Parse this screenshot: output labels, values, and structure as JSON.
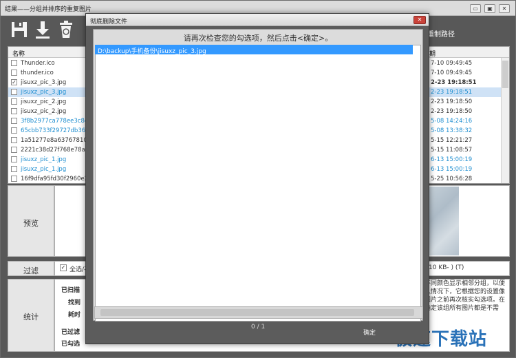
{
  "window": {
    "title": "结果——分组并排序的重复图片",
    "btn_min": "▭",
    "btn_max": "▣",
    "btn_close": "✕"
  },
  "toolbar": {
    "icons": [
      "save-icon",
      "download-icon",
      "trash-icon"
    ],
    "right_label": "重制路径"
  },
  "file_list": {
    "col_name": "名称",
    "col_date": "期",
    "rows": [
      {
        "name": "Thunder.ico",
        "date": "7-10 09:49:45",
        "checked": false,
        "blue": false,
        "bold": false,
        "selected": false
      },
      {
        "name": "thunder.ico",
        "date": "7-10 09:49:45",
        "checked": false,
        "blue": false,
        "bold": false,
        "selected": false
      },
      {
        "name": "jisuxz_pic_3.jpg",
        "date": "2-23 19:18:51",
        "checked": true,
        "blue": false,
        "bold": true,
        "selected": false
      },
      {
        "name": "jisuxz_pic_3.jpg",
        "date": "2-23 19:18:51",
        "checked": false,
        "blue": true,
        "bold": false,
        "selected": true
      },
      {
        "name": "jisuxz_pic_2.jpg",
        "date": "2-23 19:18:50",
        "checked": false,
        "blue": false,
        "bold": false,
        "selected": false
      },
      {
        "name": "jisuxz_pic_2.jpg",
        "date": "2-23 19:18:50",
        "checked": false,
        "blue": false,
        "bold": false,
        "selected": false
      },
      {
        "name": "3f8b2977ca778ee3c8ec5c",
        "date": "5-08 14:24:16",
        "checked": false,
        "blue": true,
        "bold": false,
        "selected": false
      },
      {
        "name": "65cbb733f29727db360a03",
        "date": "5-08 13:38:32",
        "checked": false,
        "blue": true,
        "bold": false,
        "selected": false
      },
      {
        "name": "1a51277e8a63767810b96b",
        "date": "5-15 12:21:27",
        "checked": false,
        "blue": false,
        "bold": false,
        "selected": false
      },
      {
        "name": "2221c38d27f768e78a5852",
        "date": "5-15 11:08:57",
        "checked": false,
        "blue": false,
        "bold": false,
        "selected": false
      },
      {
        "name": "jisuxz_pic_1.jpg",
        "date": "6-13 15:00:19",
        "checked": false,
        "blue": true,
        "bold": false,
        "selected": false
      },
      {
        "name": "jisuxz_pic_1.jpg",
        "date": "6-13 15:00:19",
        "checked": false,
        "blue": true,
        "bold": false,
        "selected": false
      },
      {
        "name": "16f9dfa95fd30f2960e2736",
        "date": "5-25 10:56:28",
        "checked": false,
        "blue": false,
        "bold": false,
        "selected": false
      }
    ]
  },
  "preview": {
    "label": "预览"
  },
  "filter": {
    "label": "过滤",
    "select_all": "全选/不",
    "size_filter": "10 KB- ) (T)"
  },
  "stats": {
    "label": "统计",
    "scanned": "已扫描",
    "found": "找到",
    "elapsed": "耗时",
    "filtered": "已过滤",
    "checked": "已勾选",
    "note": "不同颜色显示相邻分组，以便认情况下，它根据您的设置像图片之前再次核实勾选项。在确定该组所有图片都是不需"
  },
  "watermark": "极速下载站",
  "dialog": {
    "title": "彻底删除文件",
    "close": "✕",
    "instruction": "请再次检查您的勾选项，然后点击<确定>。",
    "items": [
      "D:\\backup\\手机备份\\jisuxz_pic_3.jpg"
    ],
    "count": "0 / 1",
    "ok": "确定"
  }
}
